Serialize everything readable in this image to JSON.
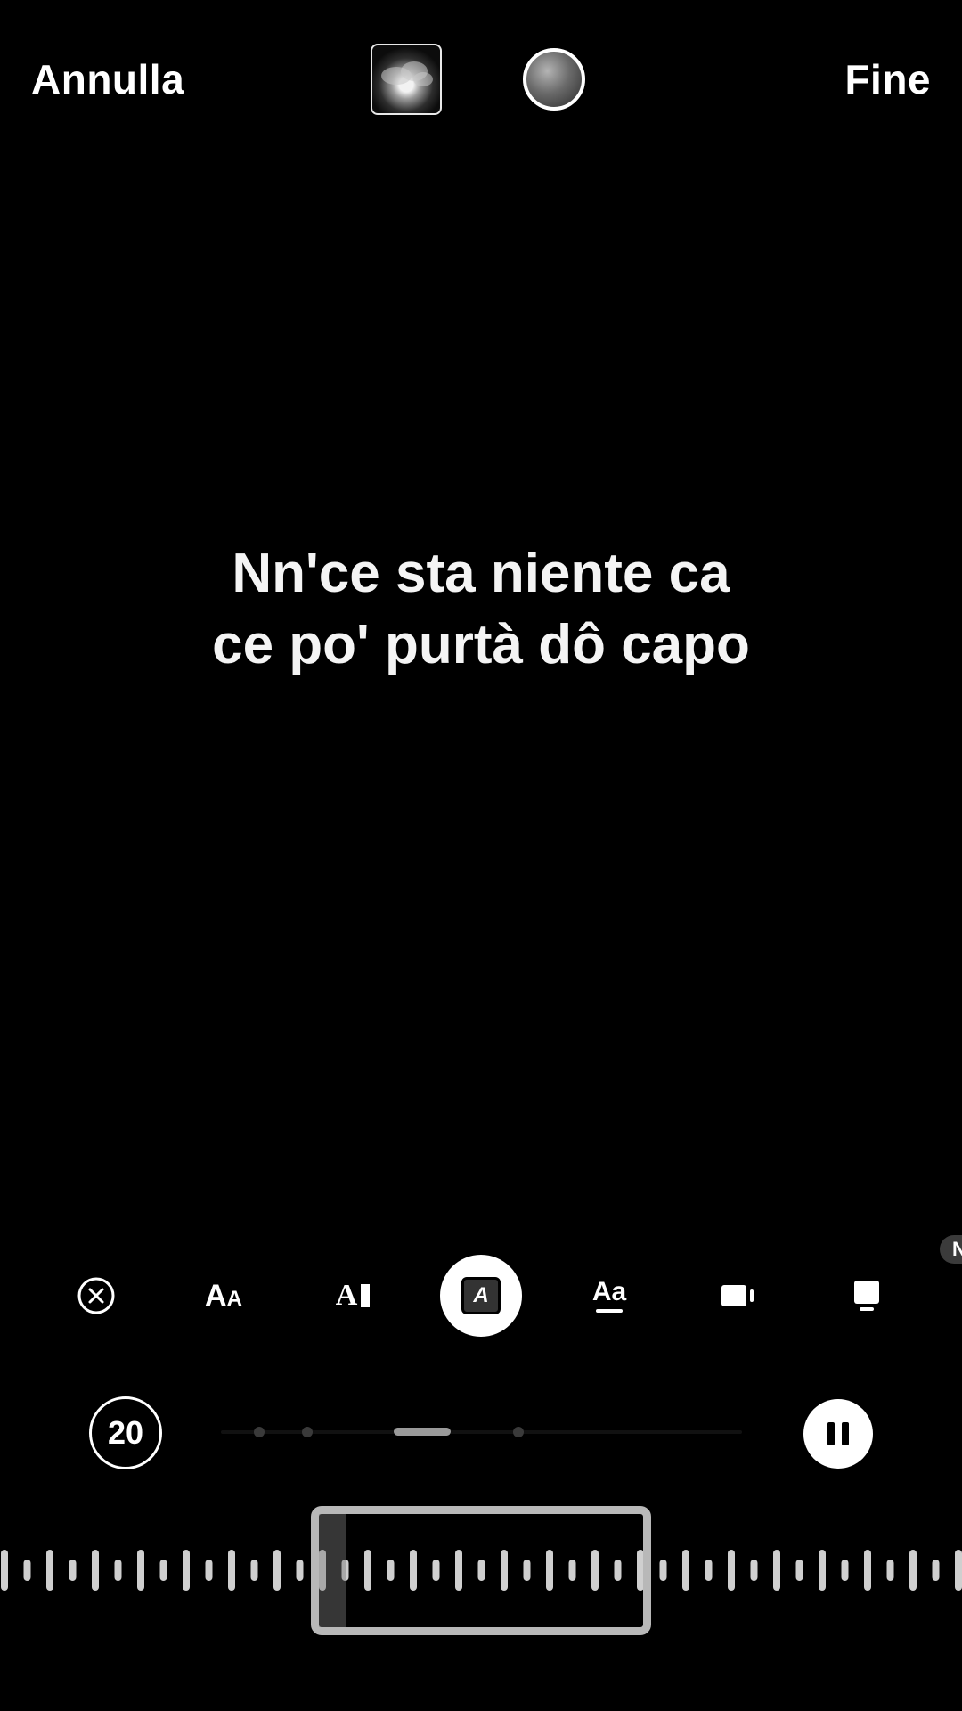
{
  "header": {
    "cancel_label": "Annulla",
    "done_label": "Fine"
  },
  "lyrics": {
    "line1": "Nn'ce sta niente ca",
    "line2": "ce po' purtà dô capo"
  },
  "toolbar": {
    "tools": [
      {
        "name": "remove",
        "icon": "close-circle-icon",
        "selected": false
      },
      {
        "name": "text-size",
        "icon": "text-size-icon",
        "selected": false
      },
      {
        "name": "typewriter",
        "icon": "typewriter-text-icon",
        "selected": false
      },
      {
        "name": "style",
        "icon": "italic-box-icon",
        "selected": true
      },
      {
        "name": "underline",
        "icon": "underline-text-icon",
        "selected": false
      },
      {
        "name": "align",
        "icon": "align-block-icon",
        "selected": false
      },
      {
        "name": "layout",
        "icon": "layout-block-icon",
        "selected": false
      }
    ],
    "glyphs": {
      "size_big": "A",
      "size_small": "A",
      "type_letter": "A",
      "style_letter": "A",
      "underline_text": "Aa"
    },
    "edge_chip_text": "N"
  },
  "playback": {
    "duration": "20",
    "state": "playing",
    "page_dots": 4,
    "active_dot": 2
  },
  "colors": {
    "background": "#000000",
    "text": "#ffffff",
    "selection_frame": "#b8b8b8",
    "waveform_bar": "#cfcfcf"
  }
}
